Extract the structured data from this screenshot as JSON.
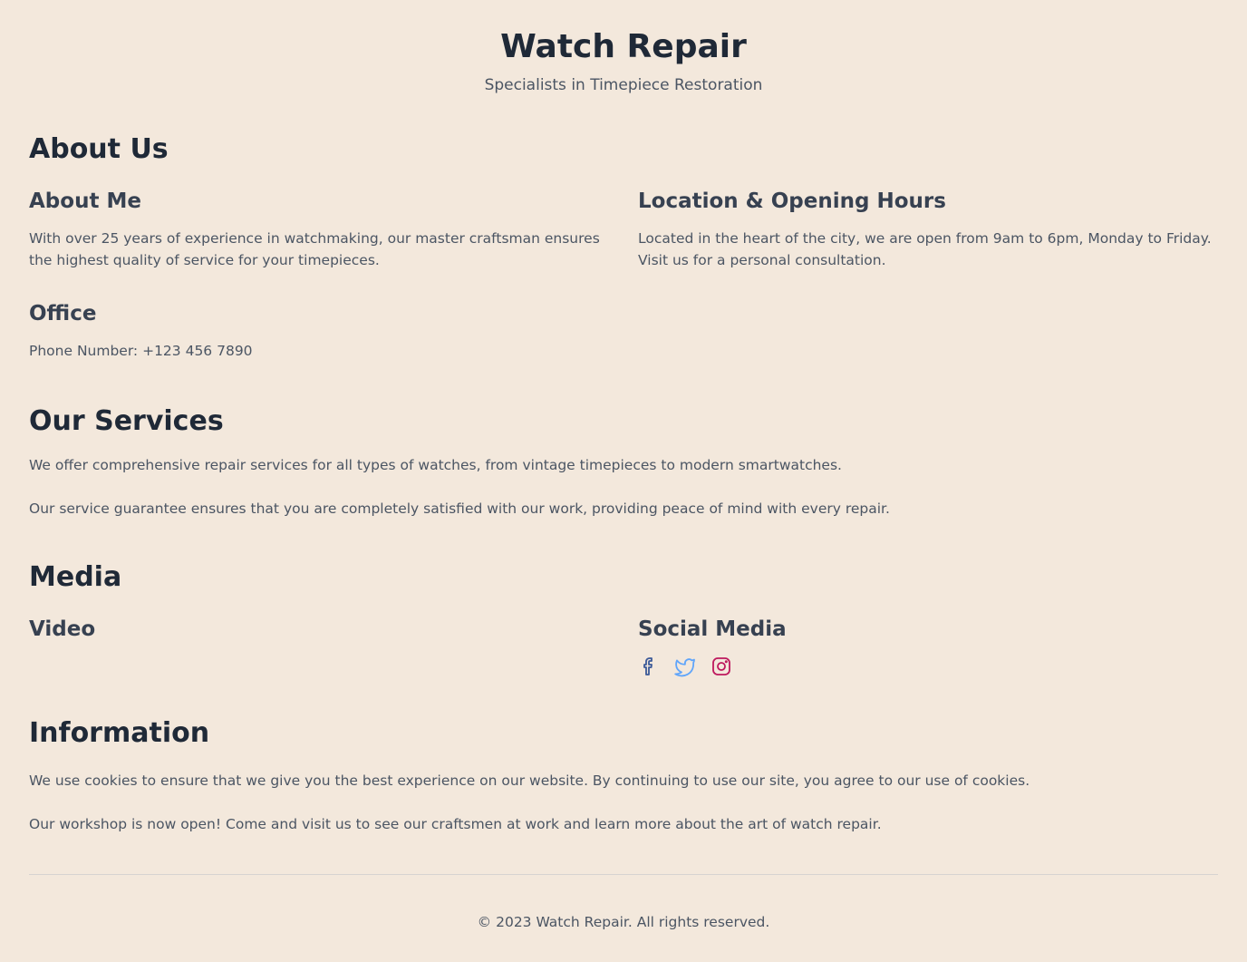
{
  "header": {
    "title": "Watch Repair",
    "tagline": "Specialists in Timepiece Restoration"
  },
  "about": {
    "title": "About Us",
    "about_me": {
      "title": "About Me",
      "text": "With over 25 years of experience in watchmaking, our master craftsman ensures the highest quality of service for your timepieces."
    },
    "location": {
      "title": "Location & Opening Hours",
      "text": "Located in the heart of the city, we are open from 9am to 6pm, Monday to Friday. Visit us for a personal consultation."
    },
    "office": {
      "title": "Office",
      "phone": "Phone Number: +123 456 7890"
    }
  },
  "services": {
    "title": "Our Services",
    "paragraphs": [
      "We offer comprehensive repair services for all types of watches, from vintage timepieces to modern smartwatches.",
      "Our service guarantee ensures that you are completely satisfied with our work, providing peace of mind with every repair."
    ]
  },
  "media": {
    "title": "Media",
    "video_title": "Video",
    "social_title": "Social Media",
    "social_icons": [
      {
        "name": "facebook-icon",
        "color": "#3b5998"
      },
      {
        "name": "twitter-icon",
        "color": "#60a5fa"
      },
      {
        "name": "instagram-icon",
        "color": "#be185d"
      }
    ]
  },
  "information": {
    "title": "Information",
    "paragraphs": [
      "We use cookies to ensure that we give you the best experience on our website. By continuing to use our site, you agree to our use of cookies.",
      "Our workshop is now open! Come and visit us to see our craftsmen at work and learn more about the art of watch repair."
    ]
  },
  "footer": {
    "text": "© 2023 Watch Repair. All rights reserved."
  },
  "colors": {
    "background": "#f3e8dc",
    "heading": "#1f2937",
    "body_text": "#4b5563"
  }
}
